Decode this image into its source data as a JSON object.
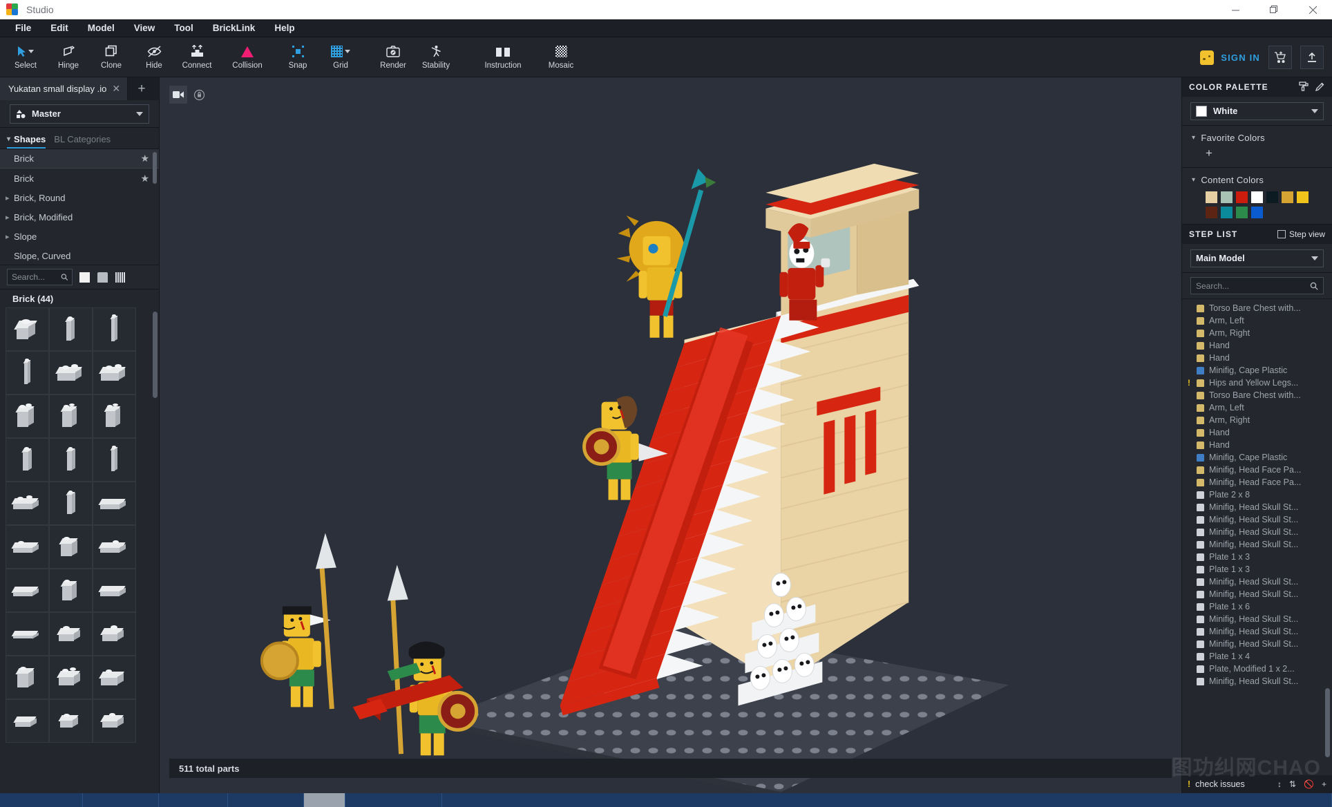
{
  "window": {
    "title": "Studio",
    "minimize_label": "—",
    "maximize_label": "❐",
    "close_label": "✕"
  },
  "menubar": {
    "items": [
      {
        "label": "File"
      },
      {
        "label": "Edit"
      },
      {
        "label": "Model"
      },
      {
        "label": "View"
      },
      {
        "label": "Tool"
      },
      {
        "label": "BrickLink"
      },
      {
        "label": "Help"
      }
    ]
  },
  "toolbar": {
    "tools": [
      {
        "label": "Select",
        "icon": "cursor-icon",
        "has_caret": true
      },
      {
        "label": "Hinge",
        "icon": "hinge-icon",
        "has_caret": false
      },
      {
        "label": "Clone",
        "icon": "clone-icon",
        "has_caret": false
      },
      {
        "label": "Hide",
        "icon": "eye-off-icon",
        "has_caret": false
      },
      {
        "label": "Connect",
        "icon": "connect-icon",
        "has_caret": false
      },
      {
        "label": "Collision",
        "icon": "warning-triangle-icon",
        "has_caret": false
      },
      {
        "label": "Snap",
        "icon": "snap-icon",
        "has_caret": false
      },
      {
        "label": "Grid",
        "icon": "grid-icon",
        "has_caret": true
      },
      {
        "label": "Render",
        "icon": "camera-icon",
        "has_caret": false
      },
      {
        "label": "Stability",
        "icon": "stability-icon",
        "has_caret": false
      },
      {
        "label": "Instruction",
        "icon": "book-icon",
        "has_caret": false
      },
      {
        "label": "Mosaic",
        "icon": "mosaic-icon",
        "has_caret": false
      }
    ],
    "sign_in_label": "SIGN IN",
    "cart_icon": "cart-icon",
    "upload_icon": "upload-icon"
  },
  "left_panel": {
    "tab": {
      "title": "Yukatan small display .io",
      "close_icon": "close-icon"
    },
    "new_tab_icon": "plus-icon",
    "master_dropdown": {
      "label": "Master"
    },
    "shapes_tab": "Shapes",
    "bl_categories_tab": "BL Categories",
    "categories": [
      {
        "label": "Brick",
        "star": true,
        "expandable": false,
        "selected": true
      },
      {
        "label": "Brick",
        "star": true,
        "expandable": false,
        "selected": false
      },
      {
        "label": "Brick, Round",
        "star": false,
        "expandable": true,
        "selected": false
      },
      {
        "label": "Brick, Modified",
        "star": false,
        "expandable": true,
        "selected": false
      },
      {
        "label": "Slope",
        "star": false,
        "expandable": true,
        "selected": false
      },
      {
        "label": "Slope, Curved",
        "star": false,
        "expandable": false,
        "selected": false
      }
    ],
    "search_placeholder": "Search...",
    "search_value": "",
    "view_icons": [
      "square-white-icon",
      "bucket-icon",
      "grid-view-icon"
    ],
    "part_group_header": "Brick (44)"
  },
  "viewport": {
    "camera_icon": "camera-video-icon",
    "reset_view_icon": "reset-rotation-icon",
    "status_text": "511 total parts"
  },
  "right_panel": {
    "color_palette": {
      "title": "COLOR PALETTE",
      "paint_icon": "paint-roller-icon",
      "picker_icon": "eyedropper-icon",
      "selected_color": "White",
      "favorite_colors_label": "Favorite Colors",
      "add_favorite_icon": "plus-icon",
      "content_colors_label": "Content Colors",
      "content_colors": [
        "#e5cfa3",
        "#a8c2b4",
        "#cc1c0e",
        "#ffffff",
        "#0c1a22",
        "#d6a433",
        "#f0c41b",
        "#5c2412",
        "#0a8a9b",
        "#2c8a4b",
        "#0a5bd0"
      ]
    },
    "step_list": {
      "title": "STEP LIST",
      "step_view_label": "Step view",
      "step_view_checked": false,
      "model_dropdown": "Main Model",
      "search_placeholder": "Search...",
      "search_value": "",
      "items": [
        {
          "name": "Torso Bare Chest with...",
          "color": "#d4b96a",
          "warn": false
        },
        {
          "name": "Arm, Left",
          "color": "#d4b96a",
          "warn": false
        },
        {
          "name": "Arm, Right",
          "color": "#d4b96a",
          "warn": false
        },
        {
          "name": "Hand",
          "color": "#d4b96a",
          "warn": false
        },
        {
          "name": "Hand",
          "color": "#d4b96a",
          "warn": false
        },
        {
          "name": "Minifig, Cape Plastic",
          "color": "#3f7ec4",
          "warn": false
        },
        {
          "name": "Hips and Yellow Legs...",
          "color": "#d4b96a",
          "warn": true
        },
        {
          "name": "Torso Bare Chest with...",
          "color": "#d4b96a",
          "warn": false
        },
        {
          "name": "Arm, Left",
          "color": "#d4b96a",
          "warn": false
        },
        {
          "name": "Arm, Right",
          "color": "#d4b96a",
          "warn": false
        },
        {
          "name": "Hand",
          "color": "#d4b96a",
          "warn": false
        },
        {
          "name": "Hand",
          "color": "#d4b96a",
          "warn": false
        },
        {
          "name": "Minifig, Cape Plastic",
          "color": "#3f7ec4",
          "warn": false
        },
        {
          "name": "Minifig, Head Face Pa...",
          "color": "#d4b96a",
          "warn": false
        },
        {
          "name": "Minifig, Head Face Pa...",
          "color": "#d4b96a",
          "warn": false
        },
        {
          "name": "Plate 2 x 8",
          "color": "#cfd2d6",
          "warn": false
        },
        {
          "name": "Minifig, Head Skull St...",
          "color": "#cfd2d6",
          "warn": false
        },
        {
          "name": "Minifig, Head Skull St...",
          "color": "#cfd2d6",
          "warn": false
        },
        {
          "name": "Minifig, Head Skull St...",
          "color": "#cfd2d6",
          "warn": false
        },
        {
          "name": "Minifig, Head Skull St...",
          "color": "#cfd2d6",
          "warn": false
        },
        {
          "name": "Plate 1 x 3",
          "color": "#cfd2d6",
          "warn": false
        },
        {
          "name": "Plate 1 x 3",
          "color": "#cfd2d6",
          "warn": false
        },
        {
          "name": "Minifig, Head Skull St...",
          "color": "#cfd2d6",
          "warn": false
        },
        {
          "name": "Minifig, Head Skull St...",
          "color": "#cfd2d6",
          "warn": false
        },
        {
          "name": "Plate 1 x 6",
          "color": "#cfd2d6",
          "warn": false
        },
        {
          "name": "Minifig, Head Skull St...",
          "color": "#cfd2d6",
          "warn": false
        },
        {
          "name": "Minifig, Head Skull St...",
          "color": "#cfd2d6",
          "warn": false
        },
        {
          "name": "Minifig, Head Skull St...",
          "color": "#cfd2d6",
          "warn": false
        },
        {
          "name": "Plate 1 x 4",
          "color": "#cfd2d6",
          "warn": false
        },
        {
          "name": "Plate, Modified 1 x 2...",
          "color": "#cfd2d6",
          "warn": false
        },
        {
          "name": "Minifig, Head Skull St...",
          "color": "#cfd2d6",
          "warn": false
        }
      ]
    },
    "issue_bar": {
      "label": "check issues",
      "warn_icon": "warning-icon",
      "icons": [
        "collapse-icon",
        "expand-icon",
        "hide-icon",
        "add-icon"
      ]
    }
  },
  "watermark": "图功纠网CHAO"
}
